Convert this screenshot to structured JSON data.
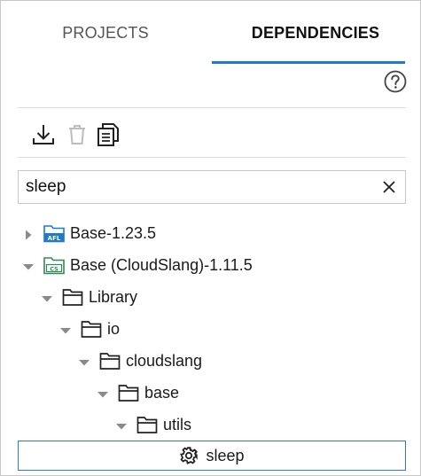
{
  "tabs": [
    {
      "label": "PROJECTS",
      "active": false
    },
    {
      "label": "DEPENDENCIES",
      "active": true
    }
  ],
  "accent_color": "#1a7bd1",
  "toolbar": {
    "icons": [
      "download-icon",
      "trash-icon",
      "copy-icon"
    ]
  },
  "search": {
    "value": "sleep",
    "placeholder": ""
  },
  "tree": [
    {
      "label": "Base-1.23.5",
      "expanded": false,
      "icon": "afl-folder-icon",
      "badge": "AFL",
      "badge_color": "#1a7bd1"
    },
    {
      "label": "Base (CloudSlang)-1.11.5",
      "expanded": true,
      "icon": "cs-folder-icon",
      "badge": "CS",
      "badge_color": "#2e8b57"
    },
    {
      "label": "Library",
      "expanded": true,
      "icon": "folder-icon"
    },
    {
      "label": "io",
      "expanded": true,
      "icon": "folder-icon"
    },
    {
      "label": "cloudslang",
      "expanded": true,
      "icon": "folder-icon"
    },
    {
      "label": "base",
      "expanded": true,
      "icon": "folder-icon"
    },
    {
      "label": "utils",
      "expanded": true,
      "icon": "folder-icon"
    }
  ],
  "selected_item": {
    "label": "sleep",
    "icon": "gear-icon"
  }
}
